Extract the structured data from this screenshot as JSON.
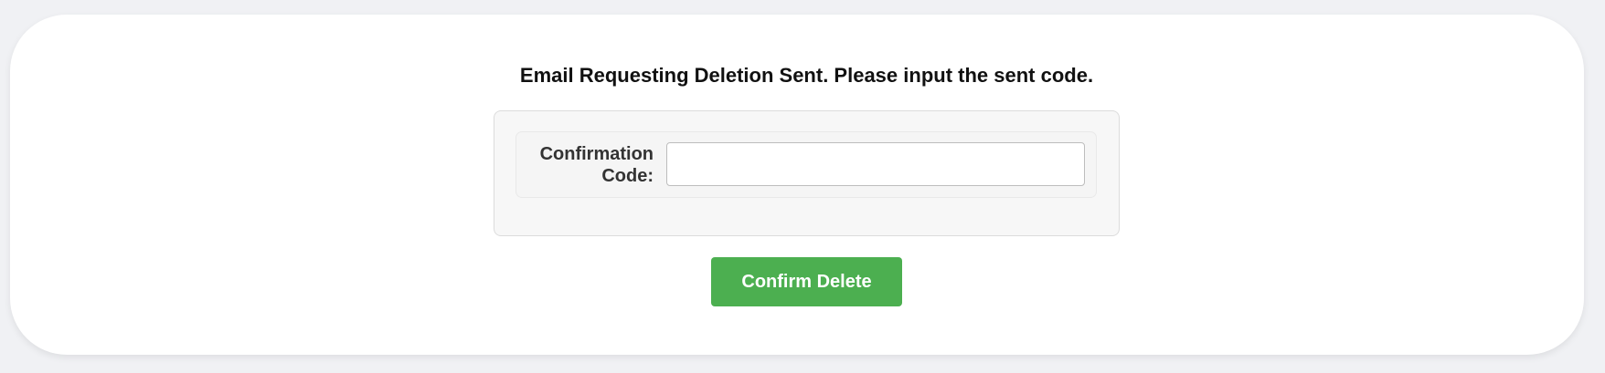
{
  "page": {
    "title": "Email Requesting Deletion Sent. Please input the sent code."
  },
  "form": {
    "confirmation_code": {
      "label": "Confirmation Code:",
      "value": "",
      "placeholder": ""
    }
  },
  "actions": {
    "confirm_delete_label": "Confirm Delete"
  },
  "colors": {
    "page_background": "#f0f1f4",
    "card_background": "#ffffff",
    "button_green": "#4caf50",
    "button_text": "#ffffff"
  }
}
